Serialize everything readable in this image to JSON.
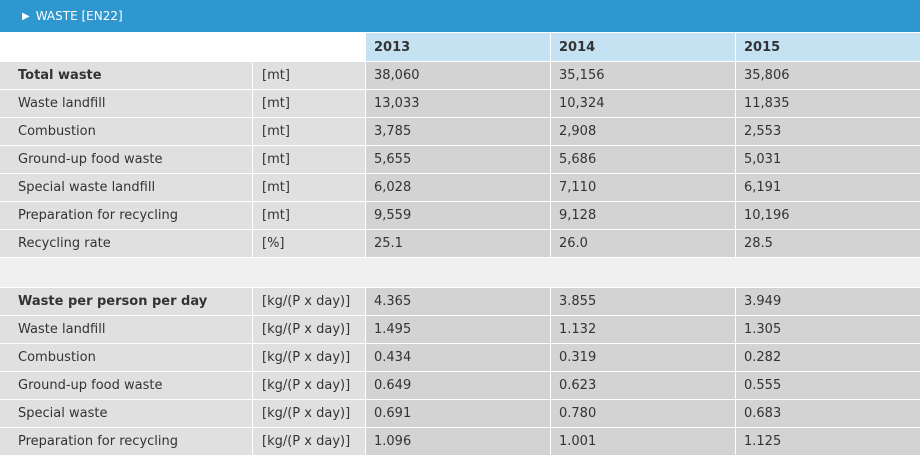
{
  "section": {
    "title": "WASTE [EN22]",
    "icon": "triangle-right-icon"
  },
  "table": {
    "years": [
      "2013",
      "2014",
      "2015"
    ],
    "group1": [
      {
        "label": "Total waste",
        "unit": "[mt]",
        "values": [
          "38,060",
          "35,156",
          "35,806"
        ],
        "total": true
      },
      {
        "label": "Waste landfill",
        "unit": "[mt]",
        "values": [
          "13,033",
          "10,324",
          "11,835"
        ]
      },
      {
        "label": "Combustion",
        "unit": "[mt]",
        "values": [
          "3,785",
          "2,908",
          "2,553"
        ]
      },
      {
        "label": "Ground-up food waste",
        "unit": "[mt]",
        "values": [
          "5,655",
          "5,686",
          "5,031"
        ]
      },
      {
        "label": "Special waste landfill",
        "unit": "[mt]",
        "values": [
          "6,028",
          "7,110",
          "6,191"
        ]
      },
      {
        "label": "Preparation for recycling",
        "unit": "[mt]",
        "values": [
          "9,559",
          "9,128",
          "10,196"
        ]
      },
      {
        "label": "Recycling rate",
        "unit": "[%]",
        "values": [
          "25.1",
          "26.0",
          "28.5"
        ]
      }
    ],
    "group2": [
      {
        "label": "Waste per person per day",
        "unit": "[kg/(P x day)]",
        "values": [
          "4.365",
          "3.855",
          "3.949"
        ],
        "total": true
      },
      {
        "label": "Waste landfill",
        "unit": "[kg/(P x day)]",
        "values": [
          "1.495",
          "1.132",
          "1.305"
        ]
      },
      {
        "label": "Combustion",
        "unit": "[kg/(P x day)]",
        "values": [
          "0.434",
          "0.319",
          "0.282"
        ]
      },
      {
        "label": "Ground-up food waste",
        "unit": "[kg/(P x day)]",
        "values": [
          "0.649",
          "0.623",
          "0.555"
        ]
      },
      {
        "label": "Special waste",
        "unit": "[kg/(P x day)]",
        "values": [
          "0.691",
          "0.780",
          "0.683"
        ]
      },
      {
        "label": "Preparation for recycling",
        "unit": "[kg/(P x day)]",
        "values": [
          "1.096",
          "1.001",
          "1.125"
        ]
      }
    ]
  },
  "colors": {
    "header_bg": "#2f97cf",
    "year_header_bg": "#c5e2f2",
    "label_bg": "#e0e0e0",
    "value_bg": "#d3d3d3"
  }
}
